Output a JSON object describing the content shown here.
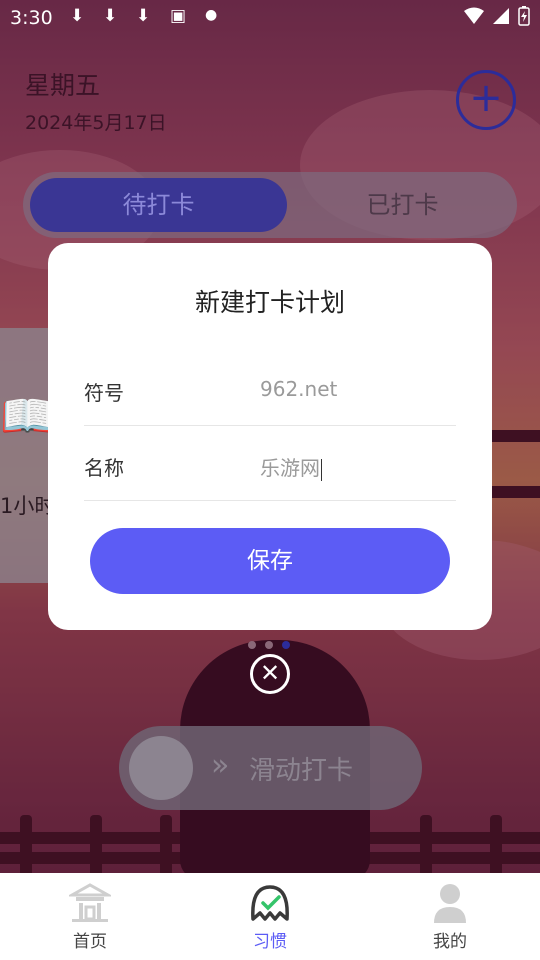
{
  "status_bar": {
    "time": "3:30"
  },
  "header": {
    "weekday": "星期五",
    "date": "2024年5月17日",
    "add_symbol": "+"
  },
  "tabs": [
    {
      "label": "待打卡",
      "active": true
    },
    {
      "label": "已打卡",
      "active": false
    }
  ],
  "background_card": {
    "text": "1小时"
  },
  "dialog": {
    "title": "新建打卡计划",
    "fields": [
      {
        "label": "符号",
        "value": "962.net"
      },
      {
        "label": "名称",
        "value": "乐游网"
      }
    ],
    "save_label": "保存"
  },
  "slider": {
    "label": "滑动打卡"
  },
  "bottom_nav": [
    {
      "label": "首页",
      "icon": "home-pavilion-icon",
      "active": false
    },
    {
      "label": "习惯",
      "icon": "habit-icon",
      "active": true
    },
    {
      "label": "我的",
      "icon": "profile-icon",
      "active": false
    }
  ],
  "colors": {
    "accent": "#5c5cf5",
    "tab_active": "#3a3694",
    "nav_active": "#5c5cf5"
  }
}
